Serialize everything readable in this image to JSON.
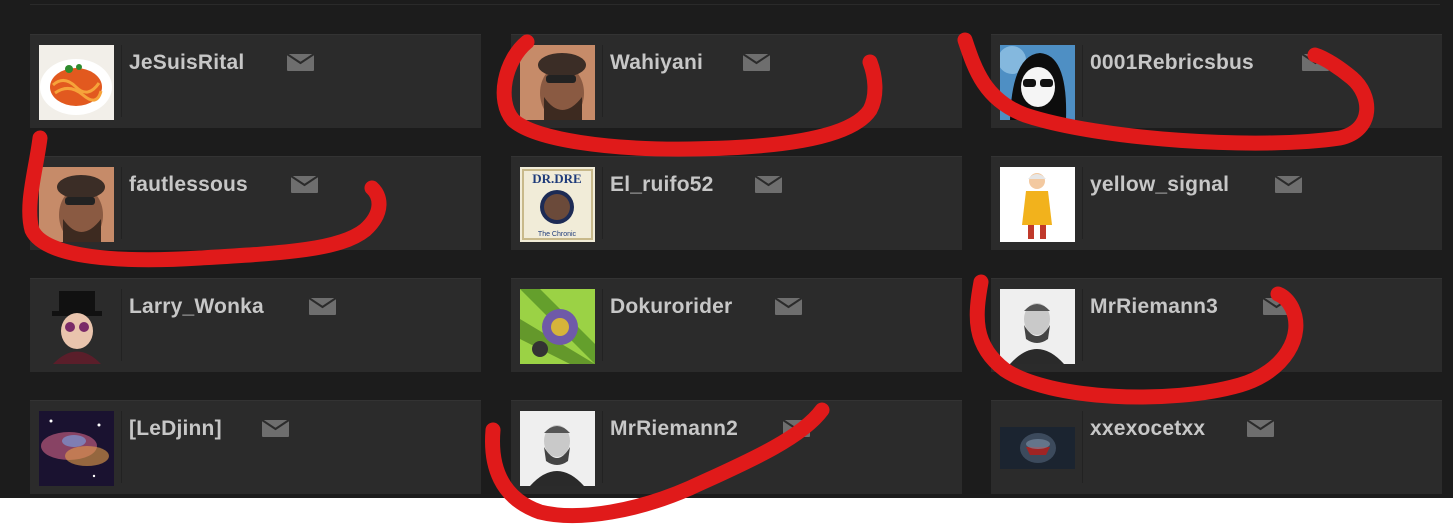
{
  "colors": {
    "panel_bg": "#1c1c1c",
    "card_bg": "#2b2b2b",
    "username_text": "#c7c7c7",
    "mail_icon": "#6e6e6e",
    "annotation_red": "#e01a1a"
  },
  "users": [
    {
      "name": "JeSuisRital",
      "avatar_icon": "spaghetti-plate-avatar-icon"
    },
    {
      "name": "Wahiyani",
      "avatar_icon": "bearded-man-cap-avatar-icon",
      "circled": true
    },
    {
      "name": "0001Rebricsbus",
      "avatar_icon": "hooded-figure-sunglasses-avatar-icon",
      "circled": true
    },
    {
      "name": "fautlessous",
      "avatar_icon": "bearded-man-cap-avatar-icon",
      "circled": true
    },
    {
      "name": "El_ruifo52",
      "avatar_icon": "dr-dre-album-avatar-icon"
    },
    {
      "name": "yellow_signal",
      "avatar_icon": "cartoon-figure-yellow-coat-avatar-icon"
    },
    {
      "name": "Larry_Wonka",
      "avatar_icon": "top-hat-character-avatar-icon"
    },
    {
      "name": "Dokurorider",
      "avatar_icon": "monster-rider-green-avatar-icon"
    },
    {
      "name": "MrRiemann3",
      "avatar_icon": "bearded-scholar-portrait-avatar-icon",
      "circled": true
    },
    {
      "name": "[LeDjinn]",
      "avatar_icon": "nebula-space-avatar-icon"
    },
    {
      "name": "MrRiemann2",
      "avatar_icon": "bearded-scholar-portrait-avatar-icon",
      "circled": true
    },
    {
      "name": "xxexocetxx",
      "avatar_icon": "armored-helmet-dark-avatar-icon"
    }
  ],
  "mail_icon": "envelope-icon"
}
